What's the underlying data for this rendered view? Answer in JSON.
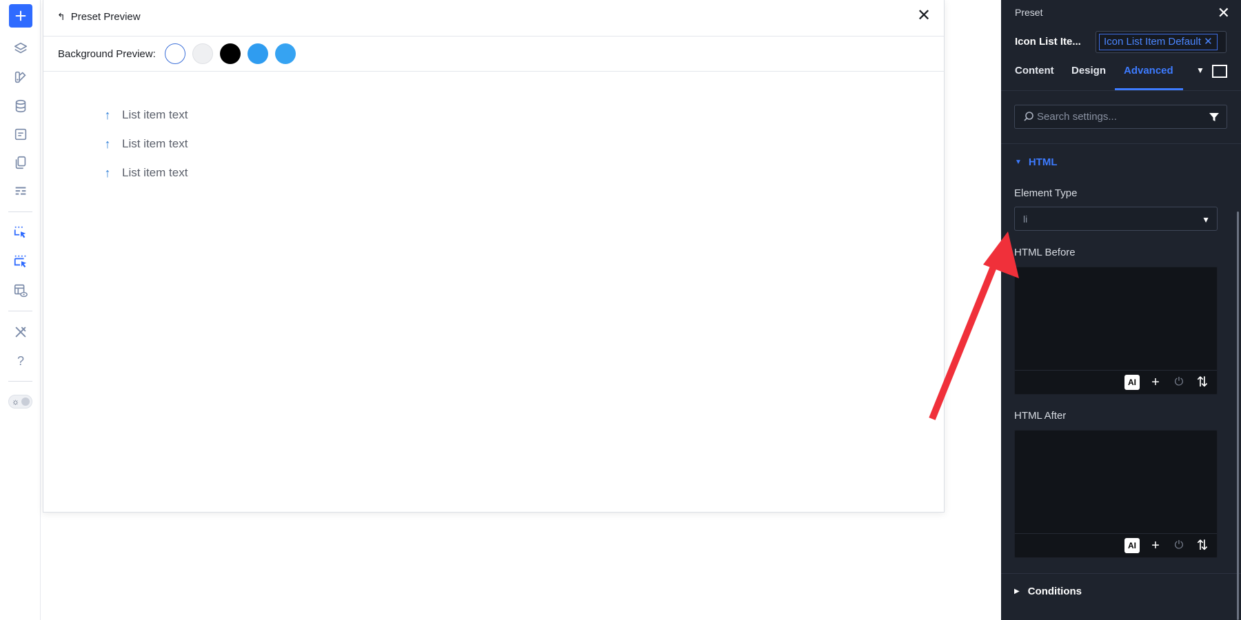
{
  "left_toolbar": {
    "icons": [
      "add-element-icon",
      "layers-icon",
      "theme-styles-icon",
      "database-icon",
      "form-icon",
      "pages-icon",
      "header-footer-icon",
      "element-select-icon",
      "element-select-active-icon",
      "template-preview-icon",
      "settings-tools-icon",
      "help-icon"
    ],
    "help_glyph": "?",
    "theme_toggle_glyph": "☼"
  },
  "preview": {
    "title": "Preset Preview",
    "back_glyph": "↰",
    "close_glyph": "✕",
    "background_label": "Background Preview:",
    "swatches": [
      "#ffffff",
      "#eff0f2",
      "#000000",
      "#2f9cf0",
      "#36a3f2"
    ],
    "list_icon_glyph": "↑",
    "list_items": [
      "List item text",
      "List item text",
      "List item text"
    ]
  },
  "panel": {
    "title": "Preset",
    "close_glyph": "✕",
    "element_name": "Icon List Ite...",
    "preset_chip": "Icon List Item Default ✕",
    "tabs": [
      "Content",
      "Design",
      "Advanced"
    ],
    "active_tab": "Advanced",
    "tab_caret": "▼",
    "search_placeholder": "Search settings...",
    "section_title": "HTML",
    "section_glyph": "▼",
    "element_type_label": "Element Type",
    "element_type_value": "li",
    "element_type_caret": "▼",
    "html_before_label": "HTML Before",
    "html_after_label": "HTML After",
    "tool_ai": "AI",
    "tool_add": "+",
    "tool_power": "⏻",
    "tool_sort": "⇅",
    "conditions_label": "Conditions",
    "conditions_glyph": "▶"
  },
  "colors": {
    "accent": "#2f6bff",
    "panel_bg": "#1e232d",
    "annotation_arrow": "#f0303a"
  }
}
